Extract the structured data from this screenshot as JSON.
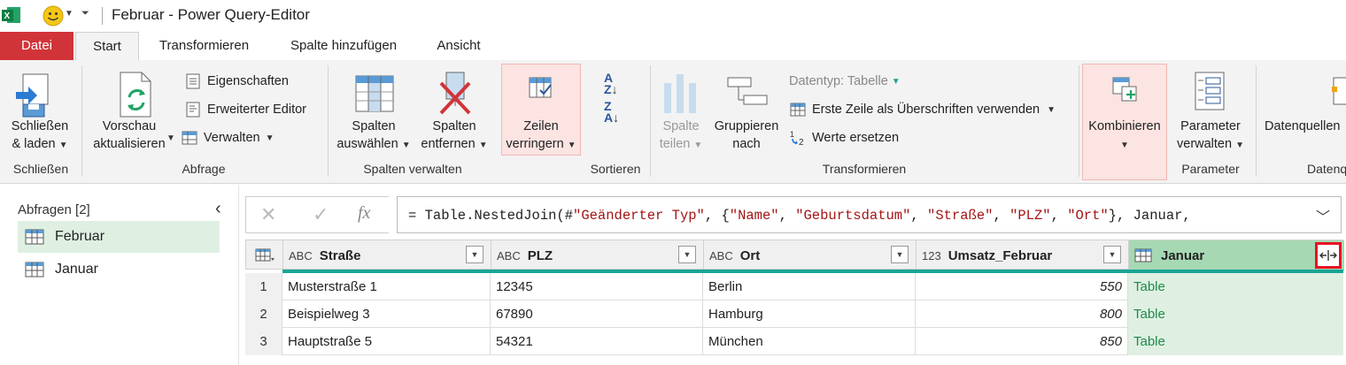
{
  "window": {
    "title": "Februar - Power Query-Editor"
  },
  "tabs": [
    {
      "label": "Datei"
    },
    {
      "label": "Start"
    },
    {
      "label": "Transformieren"
    },
    {
      "label": "Spalte hinzufügen"
    },
    {
      "label": "Ansicht"
    }
  ],
  "ribbon": {
    "close": {
      "line1": "Schließen",
      "line2": "& laden",
      "group": "Schließen"
    },
    "query": {
      "refresh_line1": "Vorschau",
      "refresh_line2": "aktualisieren",
      "properties": "Eigenschaften",
      "advanced_editor": "Erweiterter Editor",
      "manage": "Verwalten",
      "group": "Abfrage"
    },
    "columns": {
      "choose_line1": "Spalten",
      "choose_line2": "auswählen",
      "remove_line1": "Spalten",
      "remove_line2": "entfernen",
      "group": "Spalten verwalten"
    },
    "rows": {
      "line1": "Zeilen",
      "line2": "verringern"
    },
    "sort": {
      "group": "Sortieren",
      "az": "A Z",
      "za": "Z A"
    },
    "transform": {
      "split_line1": "Spalte",
      "split_line2": "teilen",
      "group_line1": "Gruppieren",
      "group_line2": "nach",
      "datatype": "Datentyp: Tabelle",
      "first_row": "Erste Zeile als Überschriften verwenden",
      "replace": "Werte ersetzen",
      "group": "Transformieren"
    },
    "combine": {
      "label": "Kombinieren"
    },
    "parameters": {
      "line1": "Parameter",
      "line2": "verwalten",
      "group": "Parameter"
    },
    "datasource": {
      "label": "Datenquellen",
      "group": "Datenq"
    }
  },
  "queries": {
    "header": "Abfragen [2]",
    "items": [
      {
        "label": "Februar"
      },
      {
        "label": "Januar"
      }
    ]
  },
  "formula": {
    "prefix": "= Table.NestedJoin(#",
    "s1": "\"Geänderter Typ\"",
    "mid1": ", {",
    "s2": "\"Name\"",
    "s3": "\"Geburtsdatum\"",
    "s4": "\"Straße\"",
    "s5": "\"PLZ\"",
    "s6": "\"Ort\"",
    "tail": "}, Januar,"
  },
  "grid": {
    "columns": [
      {
        "type": "ABC",
        "name": "Straße"
      },
      {
        "type": "ABC",
        "name": "PLZ"
      },
      {
        "type": "ABC",
        "name": "Ort"
      },
      {
        "type": "123",
        "name": "Umsatz_Februar"
      },
      {
        "type": "table",
        "name": "Januar"
      }
    ],
    "rows": [
      {
        "idx": "1",
        "strasse": "Musterstraße 1",
        "plz": "12345",
        "ort": "Berlin",
        "umsatz": "550",
        "januar": "Table"
      },
      {
        "idx": "2",
        "strasse": "Beispielweg 3",
        "plz": "67890",
        "ort": "Hamburg",
        "umsatz": "800",
        "januar": "Table"
      },
      {
        "idx": "3",
        "strasse": "Hauptstraße 5",
        "plz": "54321",
        "ort": "München",
        "umsatz": "850",
        "januar": "Table"
      }
    ]
  },
  "colors": {
    "file_tab": "#d13438",
    "selected_column": "#a6d9b3",
    "quality_bar": "#1aa595",
    "highlight_box": "#e81123"
  }
}
